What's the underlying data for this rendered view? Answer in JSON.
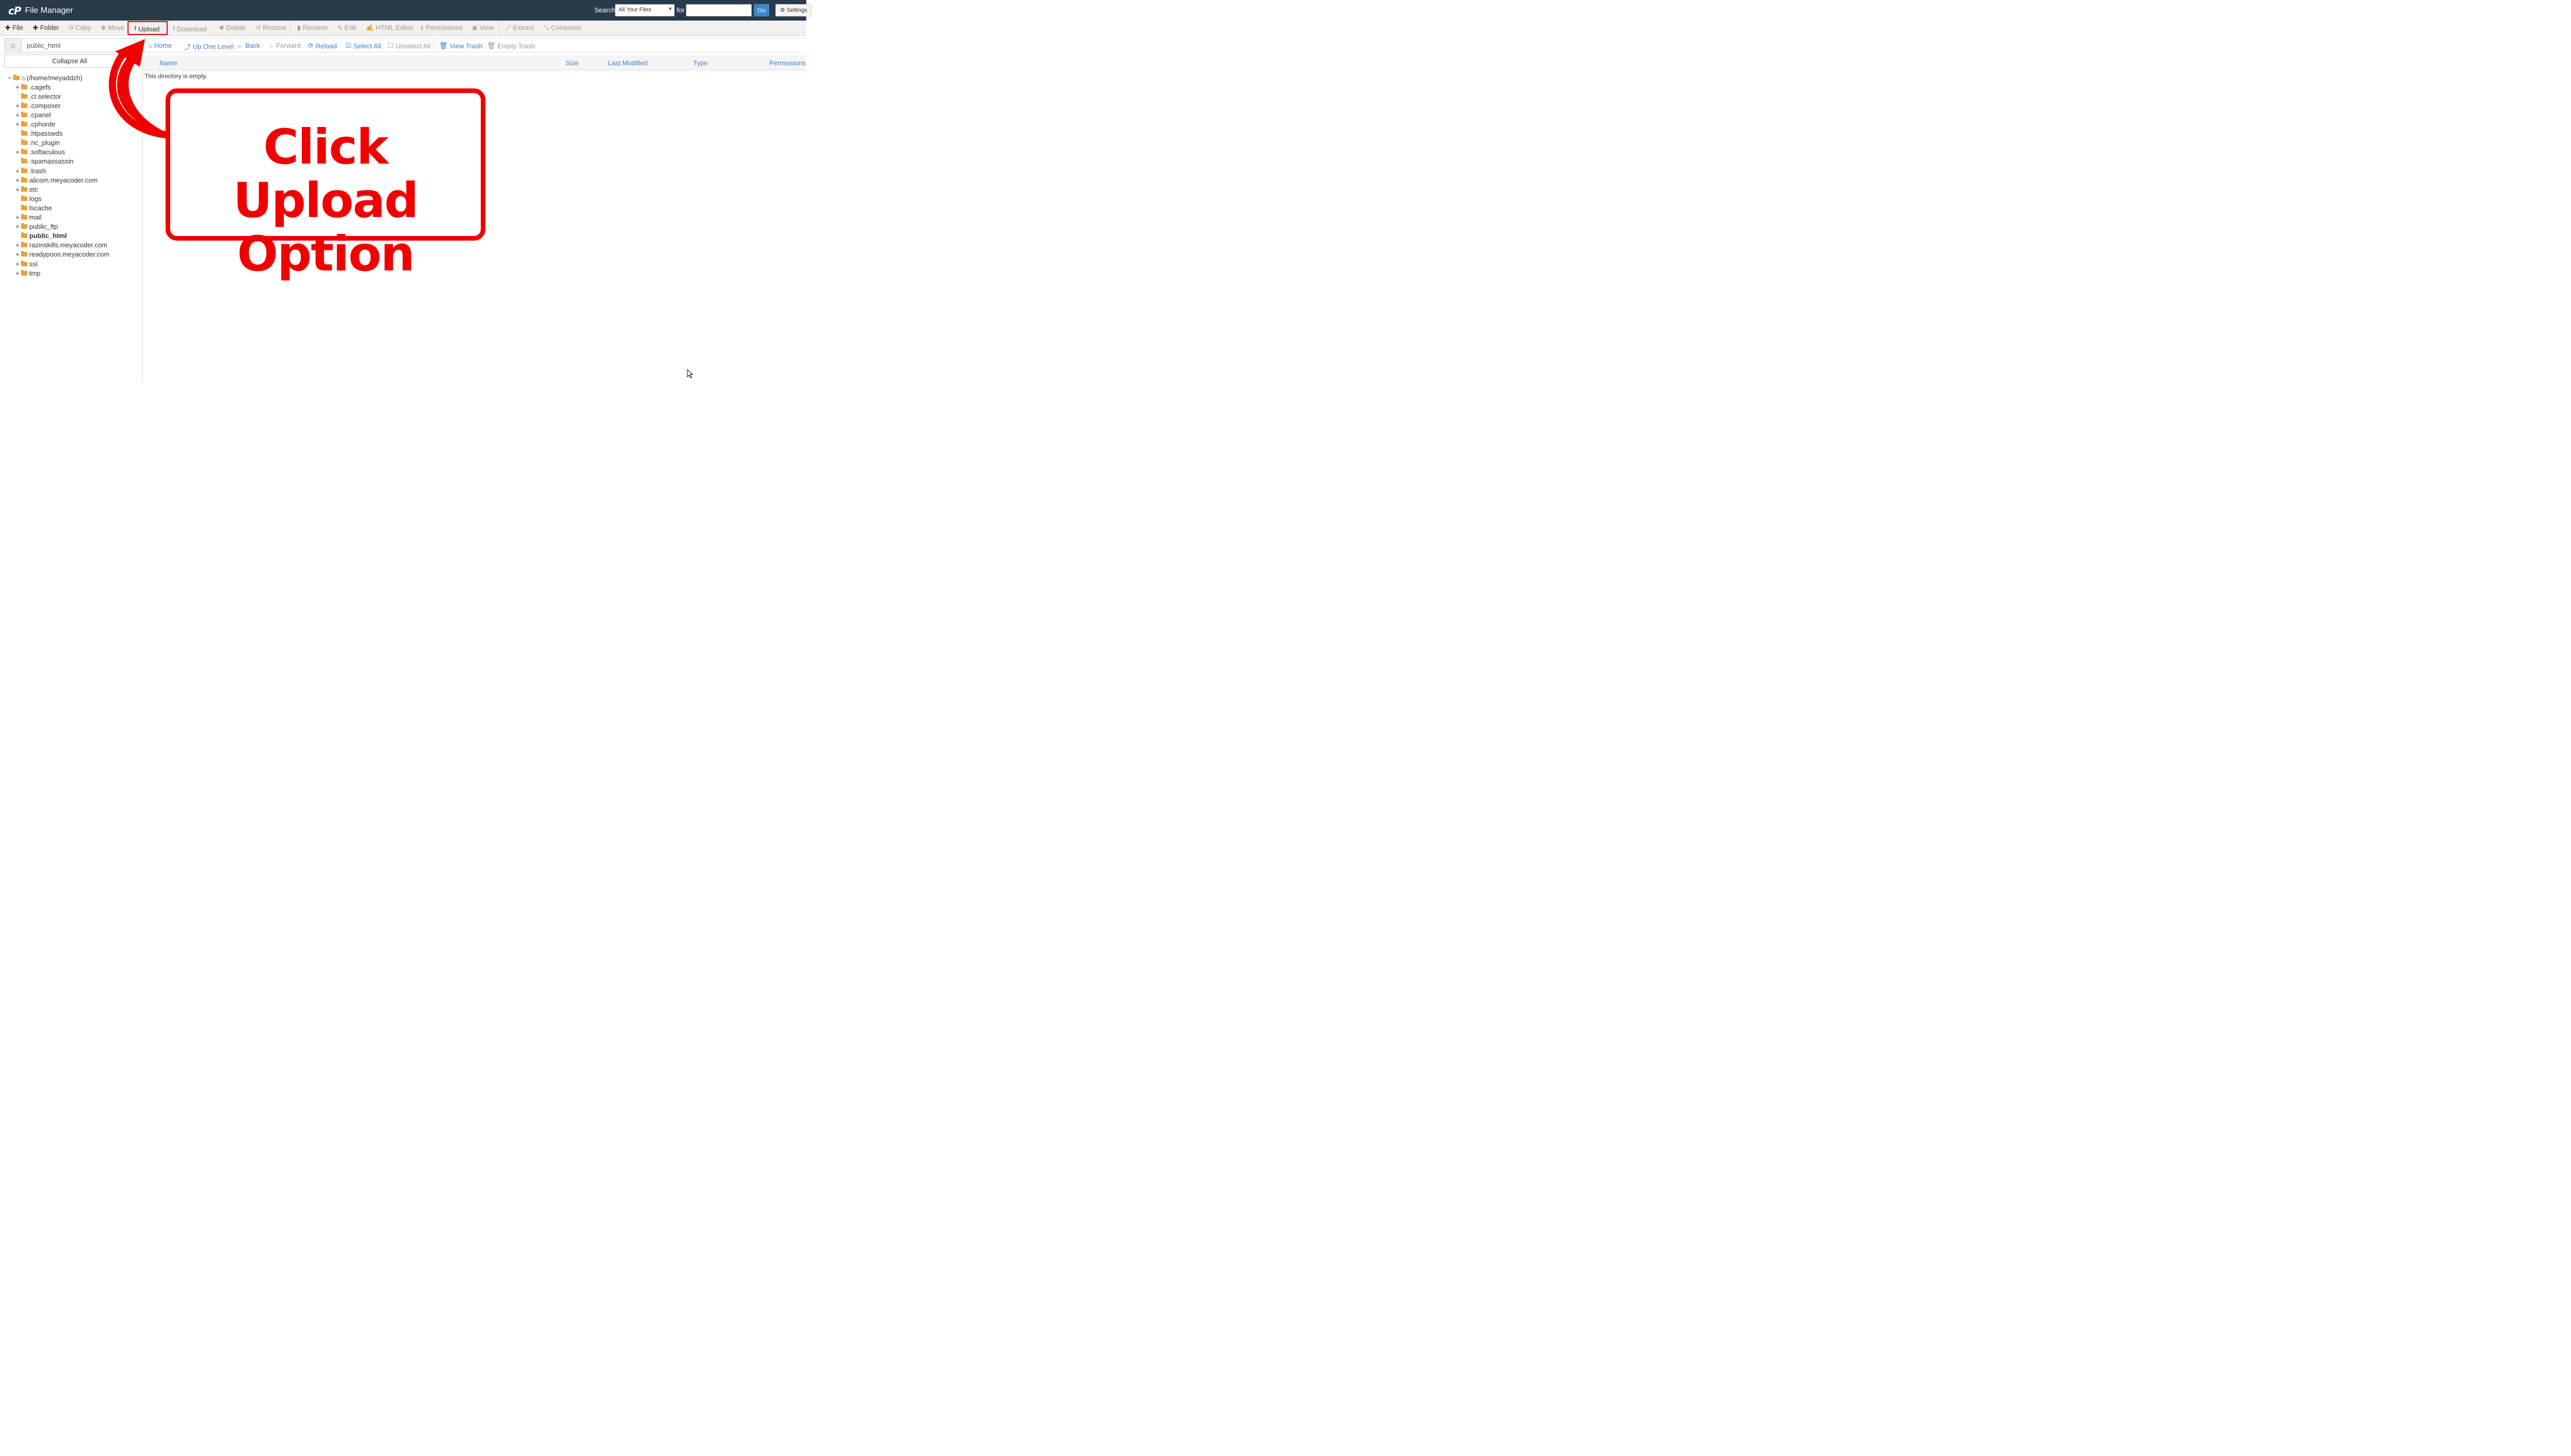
{
  "header": {
    "logo": "cP",
    "title": "File Manager",
    "search_label": "Search",
    "search_scope": "All Your Files",
    "for_label": "for",
    "search_value": "",
    "go_label": "Go",
    "settings_label": "Settings"
  },
  "toolbar": {
    "items": [
      {
        "label": "File",
        "icon": "plus-icon"
      },
      {
        "label": "Folder",
        "icon": "plus-icon"
      },
      {
        "label": "Copy",
        "icon": "copy-icon"
      },
      {
        "label": "Move",
        "icon": "move-icon"
      },
      {
        "label": "Upload",
        "icon": "upload-icon"
      },
      {
        "label": "Download",
        "icon": "download-icon"
      },
      {
        "label": "Delete",
        "icon": "close-icon"
      },
      {
        "label": "Restore",
        "icon": "restore-icon"
      },
      {
        "label": "Rename",
        "icon": "file-icon"
      },
      {
        "label": "Edit",
        "icon": "pencil-icon"
      },
      {
        "label": "HTML Editor",
        "icon": "edit-icon"
      },
      {
        "label": "Permissions",
        "icon": "key-icon"
      },
      {
        "label": "View",
        "icon": "eye-icon"
      },
      {
        "label": "Extract",
        "icon": "expand-icon"
      },
      {
        "label": "Compress",
        "icon": "compress-icon"
      }
    ]
  },
  "left": {
    "path_value": "public_html",
    "collapse_label": "Collapse All",
    "tree": [
      {
        "label": "(/home/meyaddzh)",
        "exp": "−",
        "root": true
      },
      {
        "label": ".cagefs",
        "exp": "+"
      },
      {
        "label": ".cl.selector",
        "exp": ""
      },
      {
        "label": ".composer",
        "exp": "+"
      },
      {
        "label": ".cpanel",
        "exp": "+"
      },
      {
        "label": ".cphorde",
        "exp": "+"
      },
      {
        "label": ".htpasswds",
        "exp": ""
      },
      {
        "label": ".nc_plugin",
        "exp": ""
      },
      {
        "label": ".softaculous",
        "exp": "+"
      },
      {
        "label": ".spamassassin",
        "exp": ""
      },
      {
        "label": ".trash",
        "exp": "+"
      },
      {
        "label": "alicom.meyacoder.com",
        "exp": "+"
      },
      {
        "label": "etc",
        "exp": "+"
      },
      {
        "label": "logs",
        "exp": ""
      },
      {
        "label": "lscache",
        "exp": ""
      },
      {
        "label": "mail",
        "exp": "+"
      },
      {
        "label": "public_ftp",
        "exp": "+"
      },
      {
        "label": "public_html",
        "exp": "",
        "selected": true
      },
      {
        "label": "razinskills.meyacoder.com",
        "exp": "+"
      },
      {
        "label": "readypoos.meyacoder.com",
        "exp": "+"
      },
      {
        "label": "ssl",
        "exp": "+"
      },
      {
        "label": "tmp",
        "exp": "+"
      }
    ]
  },
  "nav": {
    "items": [
      {
        "label": "Home",
        "icon": "home-icon"
      },
      {
        "label": "Up One Level",
        "icon": "level-up-icon"
      },
      {
        "label": "Back",
        "icon": "arrow-left-icon"
      },
      {
        "label": "Forward",
        "icon": "arrow-right-icon"
      },
      {
        "label": "Reload",
        "icon": "refresh-icon"
      },
      {
        "label": "Select All",
        "icon": "checkbox-checked-icon"
      },
      {
        "label": "Unselect All",
        "icon": "checkbox-empty-icon"
      },
      {
        "label": "View Trash",
        "icon": "trash-icon"
      },
      {
        "label": "Empty Trash",
        "icon": "trash-icon"
      }
    ]
  },
  "table": {
    "columns": [
      "Name",
      "Size",
      "Last Modified",
      "Type",
      "Permissions"
    ],
    "empty_message": "This directory is empty."
  },
  "annotation": {
    "line1": "Click Upload",
    "line2": "Option",
    "color": "#f20000"
  }
}
